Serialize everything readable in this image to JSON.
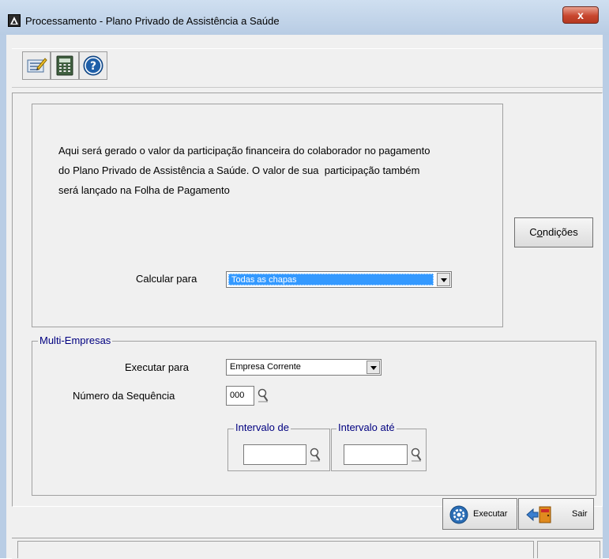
{
  "window": {
    "title": "Processamento - Plano Privado de Assistência a Saúde",
    "close_label": "x"
  },
  "toolbar": {
    "icons": [
      "edit-icon",
      "calculator-icon",
      "help-icon"
    ]
  },
  "info": {
    "line1": "Aqui será gerado o valor da participação financeira do colaborador no pagamento",
    "line2": "do Plano Privado de Assistência a Saúde. O valor de sua  participação também",
    "line3": "será lançado na Folha de Pagamento"
  },
  "conditions_button": {
    "prefix": "C",
    "accel": "o",
    "suffix": "ndições"
  },
  "calculate": {
    "label": "Calcular para",
    "selected": "Todas as chapas"
  },
  "multi_empresas": {
    "legend": "Multi-Empresas",
    "execute_label": "Executar para",
    "execute_selected": "Empresa Corrente",
    "sequence_label": "Número da Sequência",
    "sequence_value": "000",
    "interval_from_legend": "Intervalo de",
    "interval_from_value": "",
    "interval_to_legend": "Intervalo até",
    "interval_to_value": ""
  },
  "buttons": {
    "execute": "Executar",
    "exit": "Sair"
  },
  "colors": {
    "selection": "#3399ff",
    "legend_text": "#000080",
    "close_button": "#c8472f"
  }
}
